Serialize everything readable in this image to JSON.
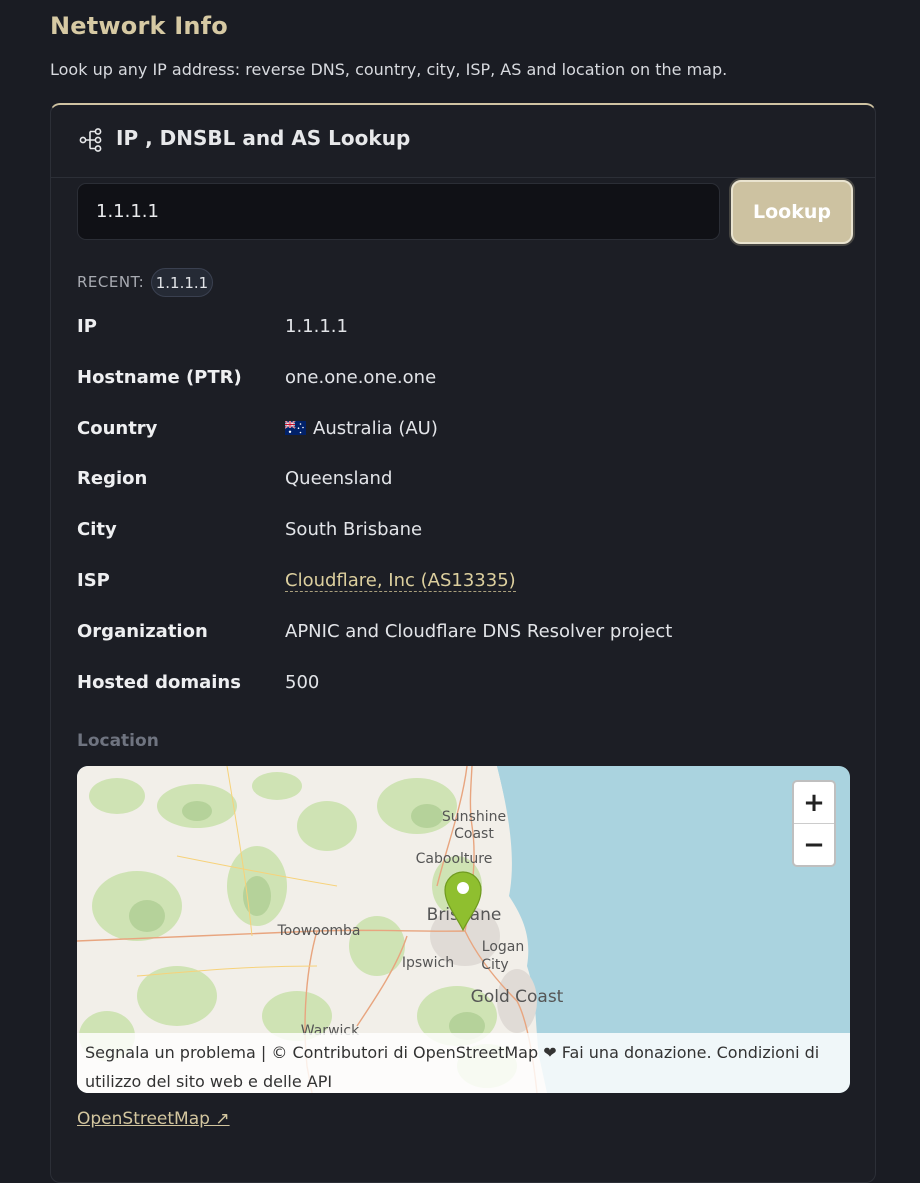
{
  "page": {
    "title": "Network Info",
    "subtitle": "Look up any IP address: reverse DNS, country, city, ISP, AS and location on the map."
  },
  "card": {
    "title": "IP , DNSBL and AS Lookup",
    "icon": "network-tree-icon"
  },
  "search": {
    "value": "1.1.1.1",
    "button_label": "Lookup"
  },
  "recent": {
    "label": "RECENT:",
    "items": [
      "1.1.1.1"
    ]
  },
  "details": [
    {
      "label": "IP",
      "value": "1.1.1.1"
    },
    {
      "label": "Hostname (PTR)",
      "value": "one.one.one.one"
    },
    {
      "label": "Country",
      "value": "Australia (AU)",
      "flag": "AU"
    },
    {
      "label": "Region",
      "value": "Queensland"
    },
    {
      "label": "City",
      "value": "South Brisbane"
    },
    {
      "label": "ISP",
      "value": "Cloudflare, Inc (AS13335)"
    },
    {
      "label": "Organization",
      "value": "APNIC and Cloudflare DNS Resolver project"
    },
    {
      "label": "Hosted domains",
      "value": "500"
    }
  ],
  "location": {
    "label": "Location",
    "map_places": [
      "Sunshine",
      "Coast",
      "Caboolture",
      "Brisbane",
      "Toowoomba",
      "Logan",
      "City",
      "Ipswich",
      "Gold Coast",
      "Warwick"
    ],
    "zoom_in": "+",
    "zoom_out": "−",
    "attribution": "Segnala un problema | © Contributori di OpenStreetMap ❤ Fai una donazione. Condizioni di utilizzo del sito web e delle API",
    "marker_color": "#8fbf2f"
  },
  "osm_link": "OpenStreetMap ↗",
  "colors": {
    "accent": "#cdc2a1",
    "background": "#1a1c23",
    "link": "#dccf9e"
  }
}
